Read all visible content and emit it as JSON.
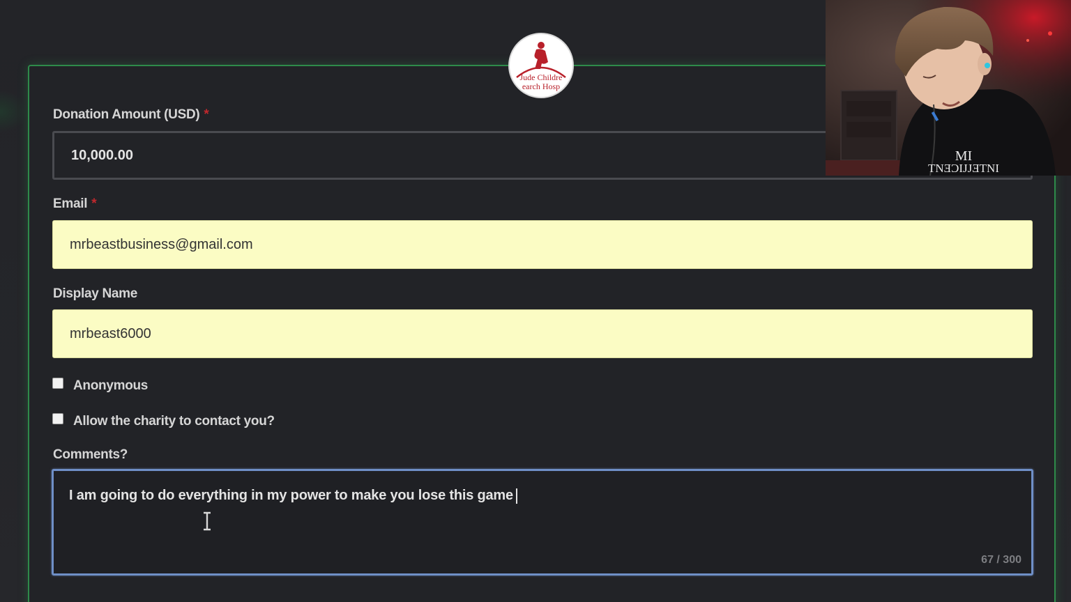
{
  "charity_logo": {
    "text_line1": "Jude Childre",
    "text_line2": "earch Hosp"
  },
  "form": {
    "donation_amount": {
      "label": "Donation Amount (USD)",
      "required_mark": "*",
      "value": "10,000.00"
    },
    "email": {
      "label": "Email",
      "required_mark": "*",
      "value": "mrbeastbusiness@gmail.com"
    },
    "display_name": {
      "label": "Display Name",
      "value": "mrbeast6000"
    },
    "anonymous": {
      "label": "Anonymous",
      "checked": false
    },
    "allow_contact": {
      "label": "Allow the charity to contact you?",
      "checked": false
    },
    "comments": {
      "label": "Comments?",
      "value": "I am going to do everything in my power to make you lose this game",
      "char_count": "67 / 300"
    }
  },
  "webcam": {
    "shirt_text_line1": "MI",
    "shirt_text_line2": "TNƎƆIJJƎTNI"
  },
  "colors": {
    "background": "#26272b",
    "card_border": "#2e8b4a",
    "autofill_yellow": "#fbfcc4",
    "required": "#c0282d",
    "focus_border": "#6f8fc7"
  }
}
